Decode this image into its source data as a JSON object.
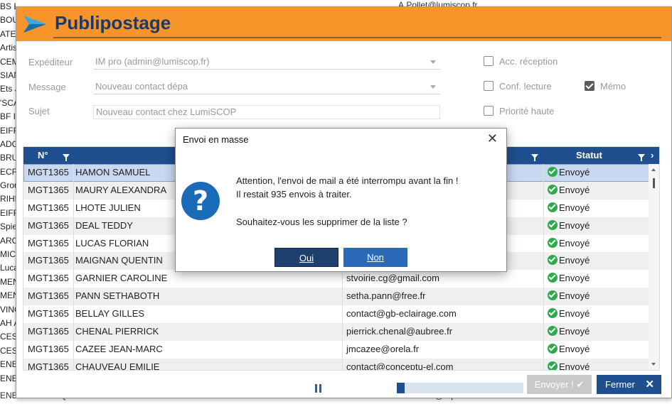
{
  "background": {
    "left_rows": [
      "BS Ent...",
      "BOU",
      "ATEL",
      "Artis",
      "CEM",
      "SIAN",
      "Ets J",
      "'SCA",
      "BF IN",
      "EIFF",
      "ADG",
      "BRU",
      "ECR",
      "Grou",
      "RIHE",
      "EIFF",
      "Spie",
      "ARC",
      "MIC",
      "Luca",
      "MEN",
      "MEN",
      "VING",
      "AH A",
      "CESI",
      "CESI",
      "ENE",
      "ENEC"
    ],
    "top_right": "A.Pollet@lumiscop.fr",
    "bottom_left": "ENEC ATLANTIQUE - LIMOGES",
    "bottom_right": "sebastien@equans.com"
  },
  "window": {
    "title": "Publipostage"
  },
  "form": {
    "expediteur_label": "Expéditeur",
    "expediteur_value": "IM pro (admin@lumiscop.fr)",
    "message_label": "Message",
    "message_value": "Nouveau contact dépa",
    "sujet_label": "Sujet",
    "sujet_value": "Nouveau contact chez LumiSCOP",
    "options": {
      "acc_reception": "Acc. réception",
      "conf_lecture": "Conf. lecture",
      "memo": "Mémo",
      "priorite_haute": "Priorité haute"
    }
  },
  "grid": {
    "headers": {
      "num": "N°",
      "statut": "Statut"
    },
    "rows": [
      {
        "code": "MGT1365",
        "name": "HAMON SAMUEL",
        "email": "",
        "status": "Envoyé"
      },
      {
        "code": "MGT1365",
        "name": "MAURY ALEXANDRA",
        "email": "",
        "status": "Envoyé"
      },
      {
        "code": "MGT1365",
        "name": "LHOTE JULIEN",
        "email": "",
        "status": "Envoyé"
      },
      {
        "code": "MGT1365",
        "name": "DEAL TEDDY",
        "email": "",
        "status": "Envoyé"
      },
      {
        "code": "MGT1365",
        "name": "LUCAS FLORIAN",
        "email": "",
        "status": "Envoyé"
      },
      {
        "code": "MGT1365",
        "name": "MAIGNAN QUENTIN",
        "email": "",
        "status": "Envoyé"
      },
      {
        "code": "MGT1365",
        "name": "GARNIER CAROLINE",
        "email": "stvoirie.cg@gmail.com",
        "status": "Envoyé"
      },
      {
        "code": "MGT1365",
        "name": "PANN SETHABOTH",
        "email": "setha.pann@free.fr",
        "status": "Envoyé"
      },
      {
        "code": "MGT1365",
        "name": "BELLAY GILLES",
        "email": "contact@gb-eclairage.com",
        "status": "Envoyé"
      },
      {
        "code": "MGT1365",
        "name": "CHENAL PIERRICK",
        "email": "pierrick.chenal@aubree.fr",
        "status": "Envoyé"
      },
      {
        "code": "MGT1365",
        "name": "CAZEE JEAN-MARC",
        "email": "jmcazee@orela.fr",
        "status": "Envoyé"
      },
      {
        "code": "MGT1365",
        "name": "CHAUVEAU EMILIE",
        "email": "contact@conceptu-el.com",
        "status": "Envoyé"
      }
    ]
  },
  "footer": {
    "progress_fraction": 0.06,
    "envoyer_label": "Envoyer !",
    "fermer_label": "Fermer"
  },
  "dialog": {
    "title": "Envoi en masse",
    "line1": "Attention, l'envoi de mail a été interrompu avant la fin !",
    "line2": "Il restait 935 envois à traiter.",
    "line3": "Souhaitez-vous les supprimer de la liste ?",
    "yes_label": "Oui",
    "no_label": "Non"
  },
  "colors": {
    "titlebar": "#f5952a",
    "header": "#1f4f8f",
    "ok_green": "#2eaa4a"
  }
}
